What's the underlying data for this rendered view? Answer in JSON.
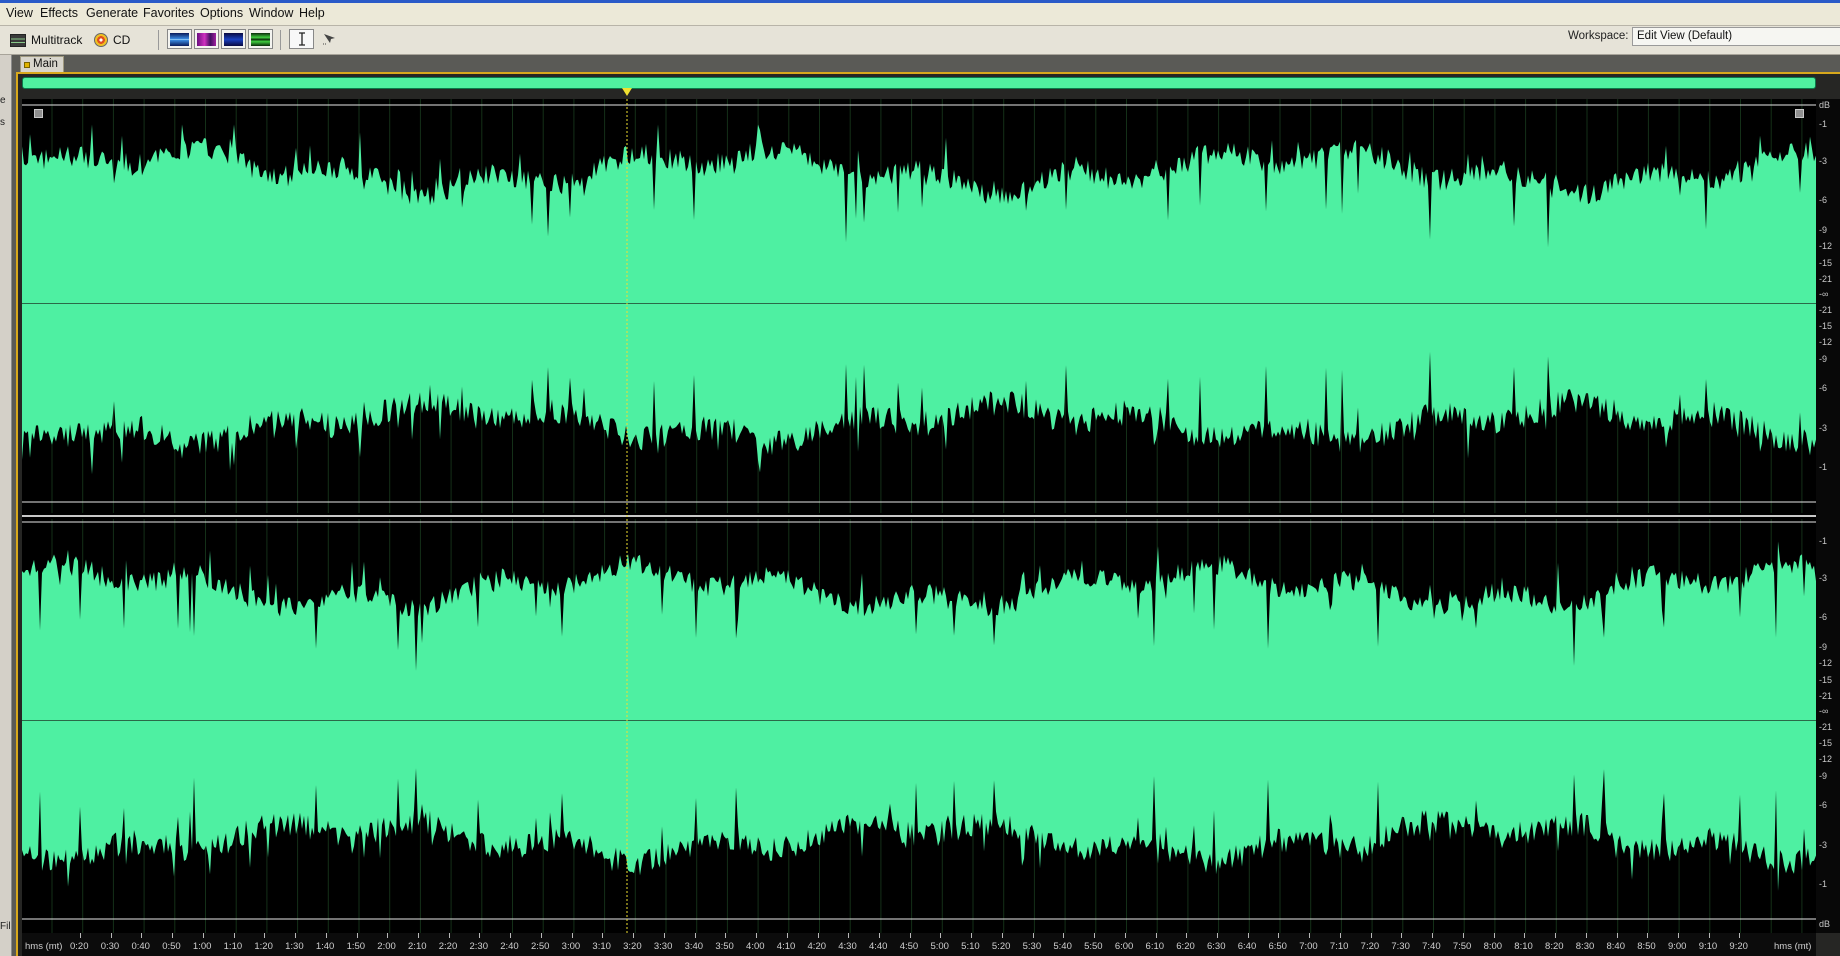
{
  "menu": {
    "items": [
      "View",
      "Effects",
      "Generate",
      "Favorites",
      "Options",
      "Window",
      "Help"
    ]
  },
  "toolbar": {
    "multitrack_label": "Multitrack",
    "cd_label": "CD",
    "workspace_label": "Workspace:",
    "workspace_value": "Edit View (Default)",
    "view_buttons": [
      "waveform-view-icon",
      "spectral-frequency-icon",
      "spectral-pan-icon",
      "spectral-phase-icon"
    ],
    "tools": [
      "time-selection-icon",
      "marquee-icon"
    ]
  },
  "tab": {
    "label": "Main"
  },
  "db_ruler": {
    "unit": "dB",
    "channel_labels": [
      "-1",
      "-3",
      "-6",
      "-9",
      "-12",
      "-15",
      "-21",
      "-∞",
      "-21",
      "-15",
      "-12",
      "-9",
      "-6",
      "-3",
      "-1"
    ]
  },
  "time_ruler": {
    "unit_label": "hms (mt)",
    "ticks": [
      "0:20",
      "0:30",
      "0:40",
      "0:50",
      "1:00",
      "1:10",
      "1:20",
      "1:30",
      "1:40",
      "1:50",
      "2:00",
      "2:10",
      "2:20",
      "2:30",
      "2:40",
      "2:50",
      "3:00",
      "3:10",
      "3:20",
      "3:30",
      "3:40",
      "3:50",
      "4:00",
      "4:10",
      "4:20",
      "4:30",
      "4:40",
      "4:50",
      "5:00",
      "5:10",
      "5:20",
      "5:30",
      "5:40",
      "5:50",
      "6:00",
      "6:10",
      "6:20",
      "6:30",
      "6:40",
      "6:50",
      "7:00",
      "7:10",
      "7:20",
      "7:30",
      "7:40",
      "7:50",
      "8:00",
      "8:10",
      "8:20",
      "8:30",
      "8:40",
      "8:50",
      "9:00",
      "9:10",
      "9:20"
    ]
  },
  "left_panel": {
    "fragments": [
      "e",
      "s",
      "Fil"
    ]
  },
  "colors": {
    "waveform": "#4ef0a2",
    "waveform_background": "#000000",
    "overview": "#50f0a0",
    "selection_border": "#d8a81c",
    "playhead": "#f0e030"
  }
}
